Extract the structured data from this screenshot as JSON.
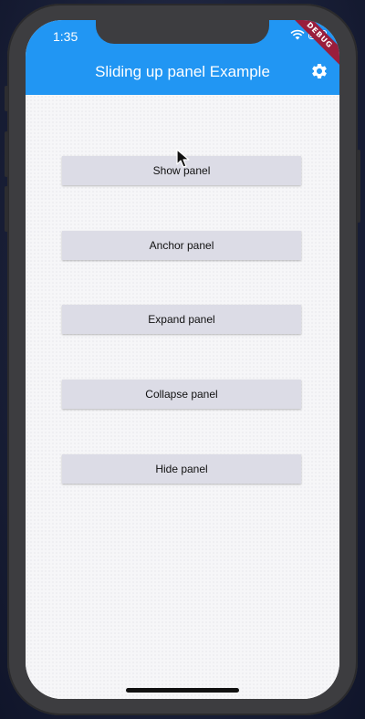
{
  "status_bar": {
    "time": "1:35",
    "debug_label": "DEBUG"
  },
  "appbar": {
    "title": "Sliding up panel Example",
    "color": "#2196f3"
  },
  "buttons": [
    {
      "label": "Show panel"
    },
    {
      "label": "Anchor panel"
    },
    {
      "label": "Expand panel"
    },
    {
      "label": "Collapse panel"
    },
    {
      "label": "Hide panel"
    }
  ],
  "icons": {
    "settings": "gear-icon",
    "wifi": "wifi-icon",
    "battery": "battery-icon",
    "pointer": "mouse-pointer-icon"
  },
  "colors": {
    "button_bg": "#dcdce6",
    "debug_banner": "#9a1d3c"
  }
}
